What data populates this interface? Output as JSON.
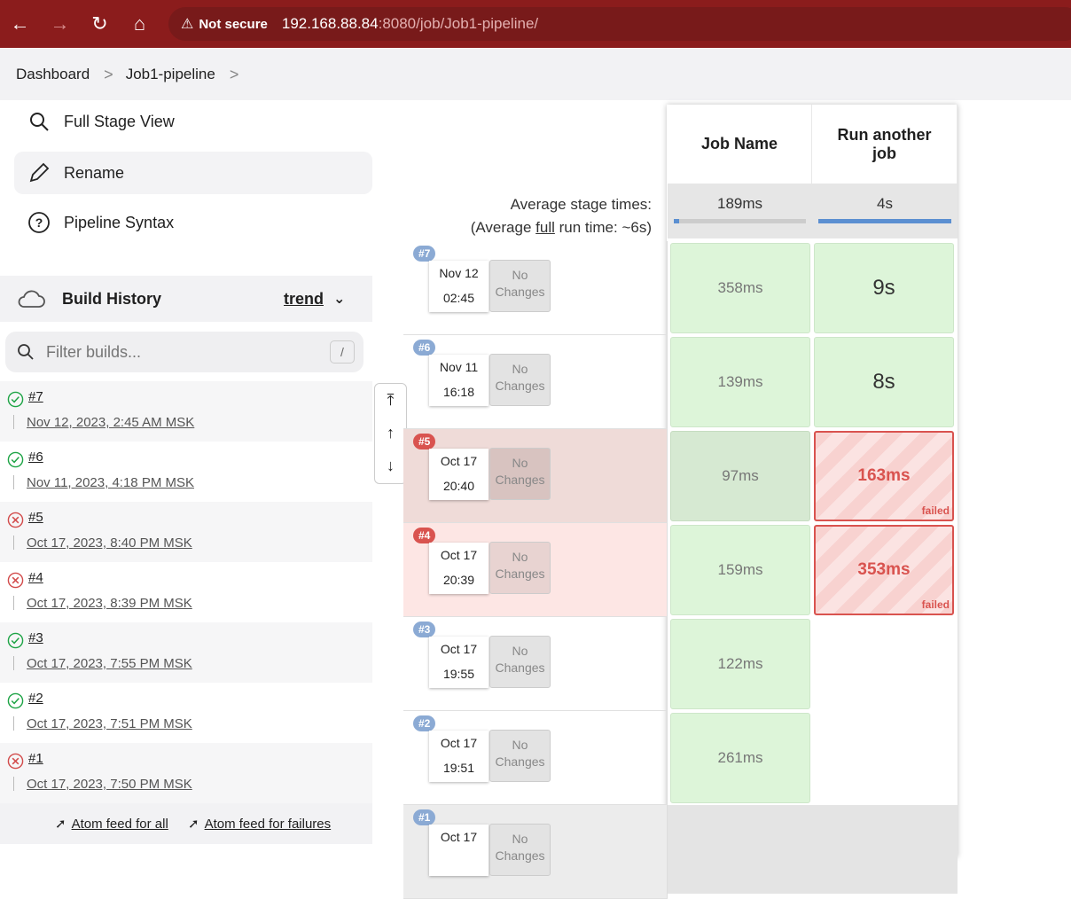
{
  "browser": {
    "security_label": "Not secure",
    "url_host": "192.168.88.84",
    "url_rest": ":8080/job/Job1-pipeline/"
  },
  "breadcrumb": {
    "items": [
      "Dashboard",
      "Job1-pipeline"
    ]
  },
  "tasks": [
    {
      "label": "Full Stage View",
      "icon": "search-icon"
    },
    {
      "label": "Rename",
      "icon": "pencil-icon"
    },
    {
      "label": "Pipeline Syntax",
      "icon": "help-icon"
    }
  ],
  "build_history": {
    "title": "Build History",
    "trend_label": "trend",
    "filter_placeholder": "Filter builds...",
    "filter_shortcut": "/",
    "builds": [
      {
        "num": "#7",
        "date": "Nov 12, 2023, 2:45 AM MSK",
        "status": "success"
      },
      {
        "num": "#6",
        "date": "Nov 11, 2023, 4:18 PM MSK",
        "status": "success"
      },
      {
        "num": "#5",
        "date": "Oct 17, 2023, 8:40 PM MSK",
        "status": "failed"
      },
      {
        "num": "#4",
        "date": "Oct 17, 2023, 8:39 PM MSK",
        "status": "failed"
      },
      {
        "num": "#3",
        "date": "Oct 17, 2023, 7:55 PM MSK",
        "status": "success"
      },
      {
        "num": "#2",
        "date": "Oct 17, 2023, 7:51 PM MSK",
        "status": "success"
      },
      {
        "num": "#1",
        "date": "Oct 17, 2023, 7:50 PM MSK",
        "status": "failed"
      }
    ],
    "feed_all": "Atom feed for all",
    "feed_failures": "Atom feed for failures"
  },
  "stage_view": {
    "avg_label": "Average stage times:",
    "avg_full_prefix": "(Average ",
    "avg_full_word": "full",
    "avg_full_suffix": " run time: ~6s)",
    "stages": [
      {
        "name": "Job Name",
        "avg": "189ms",
        "avg_fraction": 0.04
      },
      {
        "name": "Run another job",
        "avg": "4s",
        "avg_fraction": 1.0
      }
    ],
    "no_changes": [
      "No",
      "Changes"
    ],
    "failed_label": "failed",
    "runs": [
      {
        "badge": "#7",
        "date": "Nov 12",
        "time": "02:45",
        "state": "ok",
        "cells": [
          "358ms",
          "9s"
        ]
      },
      {
        "badge": "#6",
        "date": "Nov 11",
        "time": "16:18",
        "state": "ok",
        "cells": [
          "139ms",
          "8s"
        ]
      },
      {
        "badge": "#5",
        "date": "Oct 17",
        "time": "20:40",
        "state": "fail5",
        "cells": [
          "97ms",
          "163ms"
        ]
      },
      {
        "badge": "#4",
        "date": "Oct 17",
        "time": "20:39",
        "state": "fail4",
        "cells": [
          "159ms",
          "353ms"
        ]
      },
      {
        "badge": "#3",
        "date": "Oct 17",
        "time": "19:55",
        "state": "ok",
        "cells": [
          "122ms",
          ""
        ]
      },
      {
        "badge": "#2",
        "date": "Oct 17",
        "time": "19:51",
        "state": "ok",
        "cells": [
          "261ms",
          ""
        ]
      },
      {
        "badge": "#1",
        "date": "Oct 17",
        "time": "",
        "state": "gray",
        "cells": [
          "",
          ""
        ]
      }
    ]
  }
}
